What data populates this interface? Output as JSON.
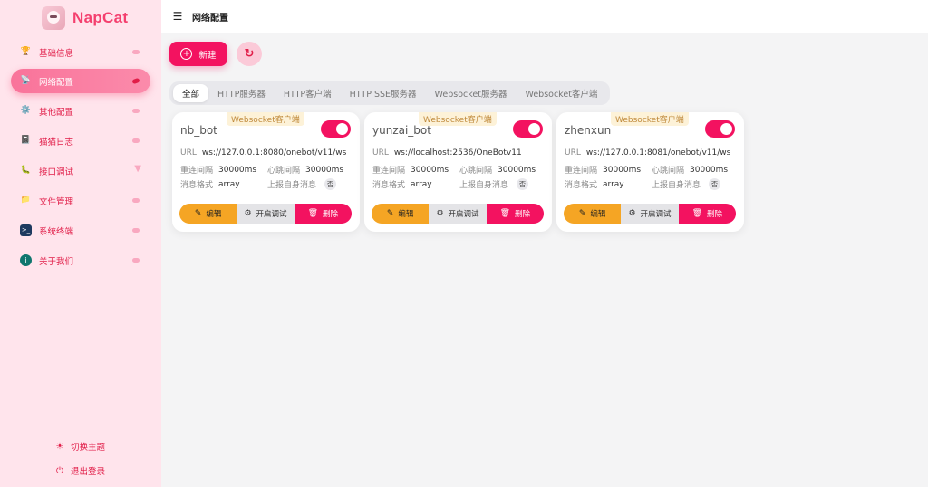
{
  "brand": {
    "name": "NapCat",
    "logo_icon": "cat-avatar-icon"
  },
  "sidebar": {
    "items": [
      {
        "label": "基础信息",
        "icon": "trophy-icon",
        "active": false
      },
      {
        "label": "网络配置",
        "icon": "broadcast-icon",
        "active": true
      },
      {
        "label": "其他配置",
        "icon": "gear-icon",
        "active": false
      },
      {
        "label": "猫猫日志",
        "icon": "notebook-icon",
        "active": false
      },
      {
        "label": "接口调试",
        "icon": "bug-icon",
        "active": false
      },
      {
        "label": "文件管理",
        "icon": "folder-icon",
        "active": false
      },
      {
        "label": "系统终端",
        "icon": "terminal-icon",
        "active": false
      },
      {
        "label": "关于我们",
        "icon": "info-icon",
        "active": false
      }
    ],
    "theme_label": "切换主题",
    "logout_label": "退出登录"
  },
  "header": {
    "title": "网络配置"
  },
  "toolbar": {
    "new_label": "新建"
  },
  "tabs": [
    "全部",
    "HTTP服务器",
    "HTTP客户端",
    "HTTP SSE服务器",
    "Websocket服务器",
    "Websocket客户端"
  ],
  "labels": {
    "url": "URL",
    "reconnect": "重连间隔",
    "heartbeat": "心跳间隔",
    "format": "消息格式",
    "report_self": "上报自身消息",
    "edit": "编辑",
    "debug": "开启调试",
    "delete": "删除"
  },
  "cards": [
    {
      "tag": "Websocket客户端",
      "name": "nb_bot",
      "enabled": true,
      "url": "ws://127.0.0.1:8080/onebot/v11/ws",
      "reconnect": "30000ms",
      "heartbeat": "30000ms",
      "format": "array",
      "report_self": "否"
    },
    {
      "tag": "Websocket客户端",
      "name": "yunzai_bot",
      "enabled": true,
      "url": "ws://localhost:2536/OneBotv11",
      "reconnect": "30000ms",
      "heartbeat": "30000ms",
      "format": "array",
      "report_self": "否"
    },
    {
      "tag": "Websocket客户端",
      "name": "zhenxun",
      "enabled": true,
      "url": "ws://127.0.0.1:8081/onebot/v11/ws",
      "reconnect": "30000ms",
      "heartbeat": "30000ms",
      "format": "array",
      "report_self": "否"
    }
  ],
  "colors": {
    "primary": "#f31260",
    "warning": "#f5a524",
    "sidebar_bg": "#ffe4ec"
  }
}
